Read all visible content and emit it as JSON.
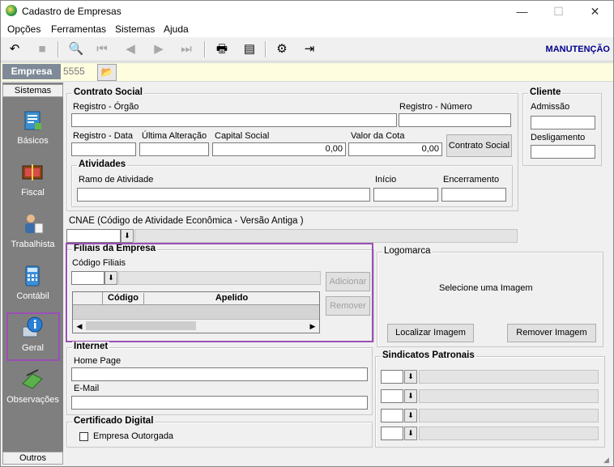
{
  "window": {
    "title": "Cadastro de Empresas",
    "minimize": "—",
    "maximize": "☐",
    "close": "✕"
  },
  "menu": [
    "Opções",
    "Ferramentas",
    "Sistemas",
    "Ajuda"
  ],
  "toolbar": {
    "mode": "MANUTENÇÃO"
  },
  "empresa": {
    "label": "Empresa",
    "code": "5555"
  },
  "sidebar": {
    "header": "Sistemas",
    "items": [
      "Básicos",
      "Fiscal",
      "Trabalhista",
      "Contábil",
      "Geral",
      "Observações"
    ],
    "footer": "Outros"
  },
  "contrato": {
    "title": "Contrato Social",
    "registro_orgao": "Registro - Órgão",
    "registro_numero": "Registro - Número",
    "registro_data": "Registro - Data",
    "ultima_alteracao": "Última Alteração",
    "capital_social": "Capital Social",
    "capital_value": "0,00",
    "valor_cota": "Valor da Cota",
    "cota_value": "0,00",
    "button": "Contrato Social"
  },
  "atividades": {
    "title": "Atividades",
    "ramo": "Ramo de Atividade",
    "inicio": "Início",
    "encerramento": "Encerramento"
  },
  "cliente": {
    "title": "Cliente",
    "admissao": "Admissão",
    "desligamento": "Desligamento"
  },
  "cnae": {
    "label": "CNAE (Código de Atividade Econômica - Versão Antiga )"
  },
  "filiais": {
    "title": "Filiais da Empresa",
    "codigo": "Código Filiais",
    "col_codigo": "Código",
    "col_apelido": "Apelido",
    "adicionar": "Adicionar",
    "remover": "Remover"
  },
  "logomarca": {
    "title": "Logomarca",
    "placeholder": "Selecione  uma  Imagem",
    "localizar": "Localizar Imagem",
    "remover": "Remover Imagem"
  },
  "internet": {
    "title": "Internet",
    "home": "Home Page",
    "email": "E-Mail"
  },
  "sindicatos": {
    "title": "Sindicatos Patronais"
  },
  "certificado": {
    "title": "Certificado Digital",
    "outorgada": "Empresa Outorgada"
  }
}
